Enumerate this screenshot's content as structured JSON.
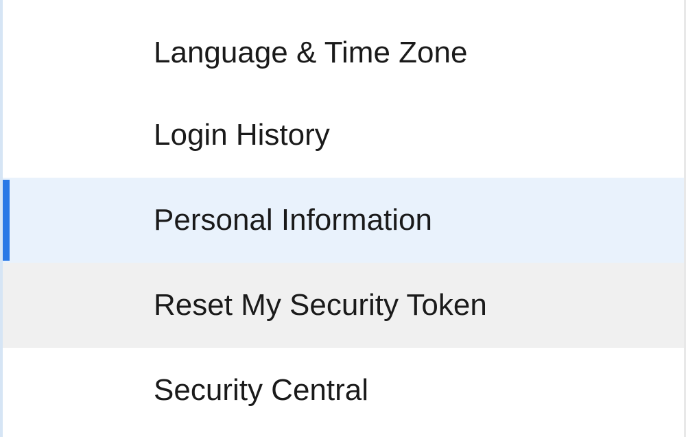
{
  "menu": {
    "items": [
      {
        "label": "Language & Time Zone",
        "state": "default"
      },
      {
        "label": "Login History",
        "state": "default"
      },
      {
        "label": "Personal Information",
        "state": "active"
      },
      {
        "label": "Reset My Security Token",
        "state": "hover"
      },
      {
        "label": "Security Central",
        "state": "default"
      }
    ]
  }
}
